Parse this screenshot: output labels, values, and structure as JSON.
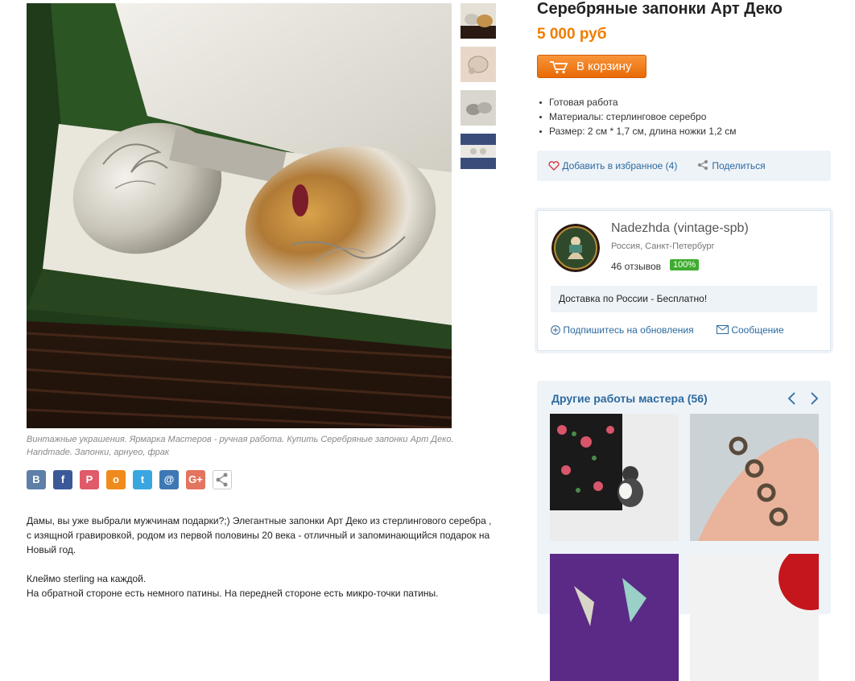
{
  "product": {
    "title": "Серебряные запонки Арт Деко",
    "price": "5 000 руб",
    "cart_label": "В корзину",
    "features": [
      "Готовая работа",
      "Материалы: стерлинговое серебро",
      "Размер: 2 см * 1,7 см, длина ножки 1,2 см"
    ],
    "favorite_label": "Добавить в избранное (4)",
    "share_label": "Поделиться"
  },
  "gallery": {
    "caption": "Винтажные украшения. Ярмарка Мастеров - ручная работа. Купить Серебряные запонки Арт Деко. Handmade. Запонки, арнуео, фрак"
  },
  "social": [
    {
      "icon": "vk-icon",
      "glyph": "B",
      "color": "#5d7fa8"
    },
    {
      "icon": "facebook-icon",
      "glyph": "f",
      "color": "#3b5998"
    },
    {
      "icon": "pinterest-icon",
      "glyph": "P",
      "color": "#e05a6a"
    },
    {
      "icon": "odnoklassniki-icon",
      "glyph": "о",
      "color": "#f08a1d"
    },
    {
      "icon": "twitter-icon",
      "glyph": "t",
      "color": "#39a6e0"
    },
    {
      "icon": "mailru-icon",
      "glyph": "@",
      "color": "#3d78b5"
    },
    {
      "icon": "googleplus-icon",
      "glyph": "G+",
      "color": "#e3745f"
    },
    {
      "icon": "share-more-icon",
      "glyph": "",
      "color": "#ffffff"
    }
  ],
  "description": {
    "p1": "Дамы, вы уже выбрали мужчинам подарки?;) Элегантные запонки Арт Деко из стерлингового серебра , с изящной гравировкой, родом из первой половины 20 века - отличный и запоминающийся подарок на Новый год.",
    "p2": "Клеймо sterling на каждой.",
    "p3": "На обратной стороне есть немного патины. На передней стороне есть микро-точки патины."
  },
  "seller": {
    "name": "Nadezhda (vintage-spb)",
    "location": "Россия, Санкт-Петербург",
    "reviews": "46 отзывов",
    "rating": "100%",
    "delivery": "Доставка по России - Бесплатно!",
    "subscribe_label": "Подпишитесь на обновления",
    "message_label": "Сообщение"
  },
  "others": {
    "title": "Другие работы мастера (56)"
  },
  "colors": {
    "accent_orange": "#f07d00",
    "link_blue": "#2d6a9f",
    "badge_green": "#3eac2e",
    "panel_bg": "#eef3f8"
  }
}
